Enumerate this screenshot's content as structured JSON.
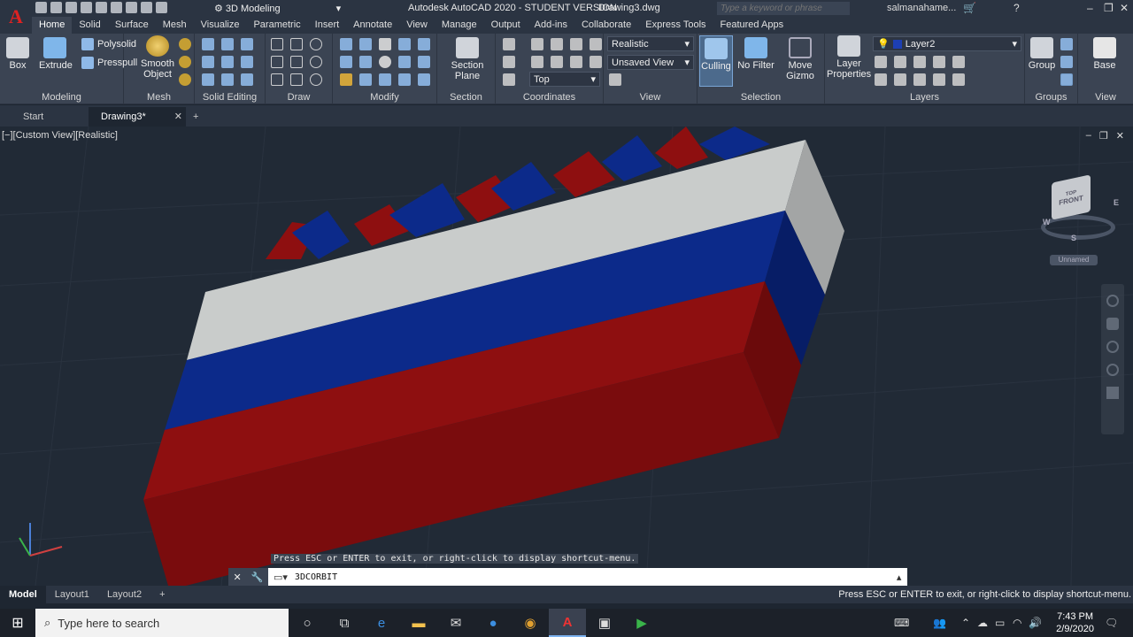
{
  "titlebar": {
    "logo": "A",
    "workspace": "3D Modeling",
    "title": "Autodesk AutoCAD 2020 - STUDENT VERSION",
    "drawing": "Drawing3.dwg",
    "search_placeholder": "Type a keyword or phrase",
    "user": "salmanahame..."
  },
  "menu": [
    "Home",
    "Solid",
    "Surface",
    "Mesh",
    "Visualize",
    "Parametric",
    "Insert",
    "Annotate",
    "View",
    "Manage",
    "Output",
    "Add-ins",
    "Collaborate",
    "Express Tools",
    "Featured Apps"
  ],
  "ribbon": {
    "modeling": {
      "title": "Modeling",
      "box": "Box",
      "extrude": "Extrude",
      "polysolid": "Polysolid",
      "presspull": "Presspull"
    },
    "mesh": {
      "title": "Mesh",
      "smooth": "Smooth Object"
    },
    "solid_editing": {
      "title": "Solid Editing"
    },
    "draw": {
      "title": "Draw"
    },
    "modify": {
      "title": "Modify"
    },
    "section": {
      "title": "Section",
      "section_plane": "Section Plane"
    },
    "coordinates": {
      "title": "Coordinates",
      "ucs_value": "Top"
    },
    "view": {
      "title": "View",
      "visual_style": "Realistic",
      "saved_view": "Unsaved View"
    },
    "selection": {
      "title": "Selection",
      "culling": "Culling",
      "no_filter": "No Filter",
      "move_gizmo": "Move Gizmo"
    },
    "layers": {
      "title": "Layers",
      "layer_properties": "Layer Properties",
      "current_layer": "Layer2"
    },
    "groups": {
      "title": "Groups",
      "group": "Group"
    },
    "viewpanel": {
      "title": "View",
      "base": "Base"
    }
  },
  "doc_tabs": {
    "start": "Start",
    "drawing": "Drawing3*"
  },
  "viewport": {
    "label": "[−][Custom View][Realistic]",
    "viewcube": {
      "top": "TOP",
      "front": "FRONT",
      "w": "W",
      "e": "E",
      "s": "S"
    },
    "ucs_name": "Unnamed",
    "colors": {
      "white": "#c9cccb",
      "blue": "#0c2a8a",
      "red": "#8e0f10"
    }
  },
  "command": {
    "hint": "Press ESC or ENTER to exit, or right-click to display shortcut-menu.",
    "value": "3DCORBIT"
  },
  "layout_tabs": [
    "Model",
    "Layout1",
    "Layout2"
  ],
  "status_msg": "Press ESC or ENTER to exit, or right-click to display shortcut-menu.",
  "taskbar": {
    "search_placeholder": "Type here to search",
    "time": "7:43 PM",
    "date": "2/9/2020"
  }
}
